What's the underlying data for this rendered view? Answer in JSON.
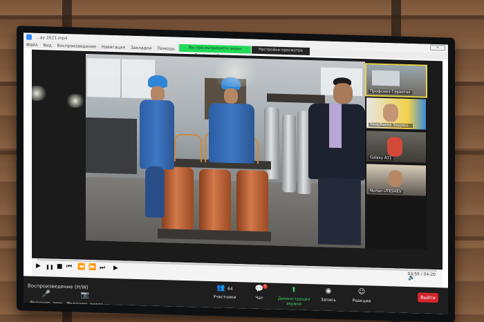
{
  "window": {
    "title": "...ay 2021.mp4",
    "close_icon": "✕"
  },
  "menu": {
    "items": [
      "Файл",
      "Вид",
      "Воспроизведение",
      "Навигация",
      "Закладки",
      "Помощь"
    ]
  },
  "share": {
    "banner": "Вы просматриваете экран Профсоюз Сервитек",
    "options": "Настройки просмотра"
  },
  "participants": [
    {
      "name": "Профсоюз Сервитек",
      "active": true
    },
    {
      "name": "Умирбаева Зауреш...",
      "active": false
    },
    {
      "name": "Galaxy A11",
      "active": false
    },
    {
      "name": "Nurlan UTESHEV",
      "active": false
    }
  ],
  "player": {
    "time": "03:59 / 04:20",
    "controls": [
      "▶",
      "❚❚",
      "■",
      "⏮",
      "⏪",
      "⏩",
      "⏭",
      "▶"
    ],
    "volume_icon": "speaker-icon"
  },
  "toolbar": {
    "playback_label": "Воспроизведение (H/W)",
    "audio_label": "Включить звук",
    "video_label": "Включить видео",
    "participants_label": "Участники",
    "participants_count": "64",
    "chat_label": "Чат",
    "chat_badge": "1",
    "share_label": "Демонстрация экрана",
    "record_label": "Запись",
    "reactions_label": "Реакции",
    "end_label": "Выйти"
  },
  "colors": {
    "share_green": "#23d959",
    "end_red": "#d3262b",
    "toolbar_bg": "#1e1e1e"
  }
}
